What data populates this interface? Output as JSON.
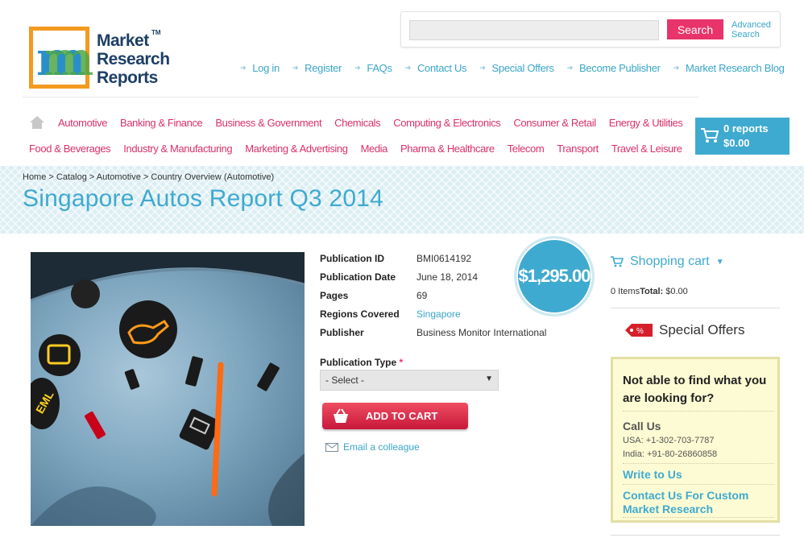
{
  "logo": {
    "line1": "Market",
    "line2": "Research",
    "line3": "Reports",
    "tm": "TM",
    "letter_m1": "m",
    "letter_m2": "m"
  },
  "search": {
    "placeholder": "",
    "button_label": "Search",
    "advanced_label": "Advanced Search"
  },
  "top_links": [
    "Log in",
    "Register",
    "FAQs",
    "Contact Us",
    "Special Offers",
    "Become Publisher",
    "Market Research Blog"
  ],
  "categories_row1": [
    "Automotive",
    "Banking & Finance",
    "Business & Government",
    "Chemicals",
    "Computing & Electronics",
    "Consumer & Retail",
    "Energy & Utilities"
  ],
  "categories_row2": [
    "Food & Beverages",
    "Industry & Manufacturing",
    "Marketing & Advertising",
    "Media",
    "Pharma & Healthcare",
    "Telecom",
    "Transport",
    "Travel & Leisure"
  ],
  "cart_box": {
    "reports": "0 reports",
    "total": "$0.00"
  },
  "breadcrumb": [
    "Home",
    "Catalog",
    "Automotive",
    "Country Overview (Automotive)"
  ],
  "breadcrumb_sep": ">",
  "page_title": "Singapore Autos Report Q3 2014",
  "product": {
    "price": "$1,295.00",
    "details": [
      {
        "label": "Publication ID",
        "value": "BMI0614192"
      },
      {
        "label": "Publication Date",
        "value": "June 18, 2014"
      },
      {
        "label": "Pages",
        "value": "69"
      },
      {
        "label": "Regions Covered",
        "value": "Singapore"
      },
      {
        "label": "Publisher",
        "value": "Business Monitor International"
      }
    ],
    "pubtype_label": "Publication Type",
    "pubtype_required": "*",
    "pubtype_selected": "- Select -",
    "add_to_cart": "ADD TO CART",
    "email_colleague": "Email a colleague"
  },
  "sidebar": {
    "cart_title": "Shopping cart",
    "cart_items": "0 Items",
    "cart_total_label": "Total:",
    "cart_total": "$0.00",
    "special_offers": "Special Offers",
    "special_tag": "%",
    "help_question": "Not able to find what you are looking for?",
    "call_us": "Call Us",
    "usa_phone": "USA: +1-302-703-7787",
    "india_phone": "India: +91-80-26860858",
    "write_to_us": "Write to Us",
    "contact_custom": "Contact Us For Custom Market Research"
  },
  "colors": {
    "accent_blue": "#3faad0",
    "accent_pink": "#d9316b",
    "search_btn": "#e8336b",
    "logo_orange": "#f39a1f"
  }
}
